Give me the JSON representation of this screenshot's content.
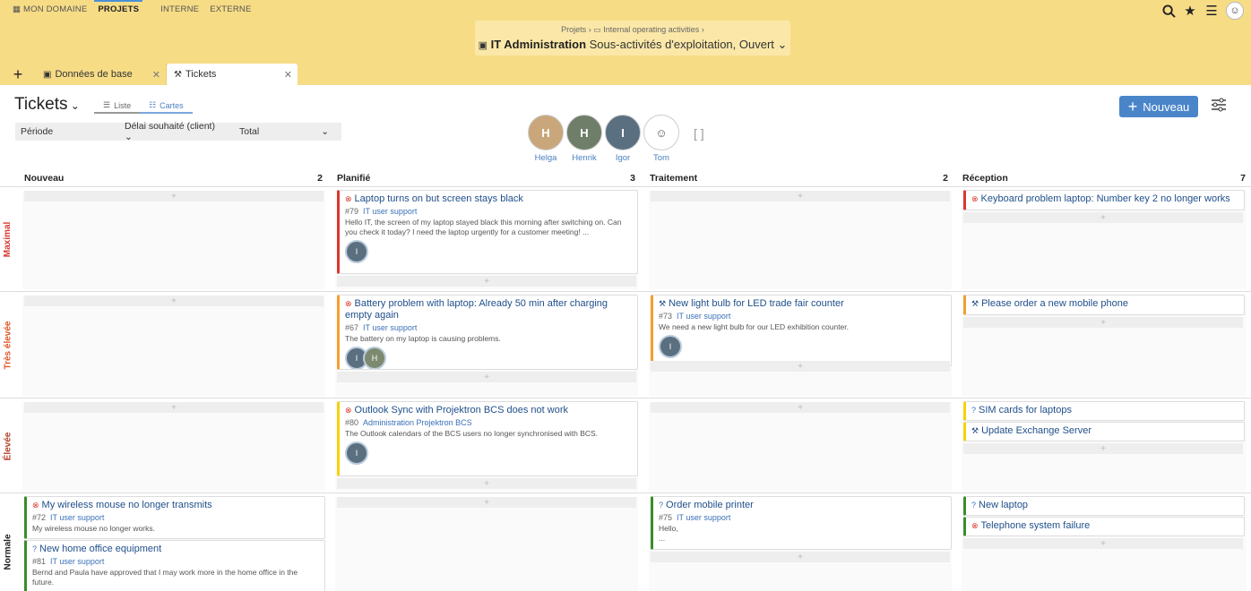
{
  "topnav": {
    "items": [
      {
        "label": "Mon domaine",
        "active": false
      },
      {
        "label": "Projets",
        "active": true
      },
      {
        "label": "Interne",
        "active": false
      },
      {
        "label": "Externe",
        "active": false
      }
    ],
    "icons": [
      "search-icon",
      "star-icon",
      "menu-icon",
      "user-avatar"
    ]
  },
  "project": {
    "crumb1": "Projets",
    "crumb_sep": "›",
    "crumb2": "Internal operating activities",
    "title": "IT Administration",
    "subtitle": "Sous-activités d'exploitation, Ouvert"
  },
  "tabs": [
    {
      "label": "Données de base"
    },
    {
      "label": "Tickets"
    }
  ],
  "page": {
    "title": "Tickets",
    "view_list": "Liste",
    "view_cards": "Cartes",
    "filter_period": "Période",
    "filter_deadline": "Délai souhaité (client)",
    "filter_total": "Total",
    "new_button": "Nouveau"
  },
  "people": [
    "Helga",
    "Henrik",
    "Igor",
    "Tom"
  ],
  "columns": [
    {
      "name": "Nouveau",
      "count": "2"
    },
    {
      "name": "Planifié",
      "count": "3"
    },
    {
      "name": "Traitement",
      "count": "2"
    },
    {
      "name": "Réception",
      "count": "7"
    }
  ],
  "lanes": [
    {
      "name": "Maximal",
      "color": "#d9372d"
    },
    {
      "name": "Très élevée",
      "color": "#e2572b"
    },
    {
      "name": "Élevée",
      "color": "#b4432c"
    },
    {
      "name": "Normale",
      "color": "#222222"
    }
  ],
  "cards": {
    "c79": {
      "title": "Laptop turns on but screen stays black",
      "id": "#79",
      "project": "IT user support",
      "desc": "Hello IT, the screen of my laptop stayed black this morning after switching on. Can you check it today? I need the laptop urgently for a customer meeting! ..."
    },
    "c_kb": {
      "title": "Keyboard problem laptop: Number key 2 no longer works"
    },
    "c67": {
      "title": "Battery problem with laptop: Already 50 min after charging empty again",
      "id": "#67",
      "project": "IT user support",
      "desc": "The battery on my laptop is causing problems."
    },
    "c73": {
      "title": "New light bulb for LED trade fair counter",
      "id": "#73",
      "project": "IT user support",
      "desc": "We need a new light bulb for our LED exhibition counter."
    },
    "c_phone": {
      "title": "Please order a new mobile phone"
    },
    "c80": {
      "title": "Outlook Sync with Projektron BCS does not work",
      "id": "#80",
      "project": "Administration Projektron BCS",
      "desc": "The Outlook calendars of the BCS users no longer synchronised with BCS."
    },
    "c_sim": {
      "title": "SIM cards for laptops"
    },
    "c_exch": {
      "title": "Update Exchange Server"
    },
    "c72": {
      "title": "My wireless mouse no longer transmits",
      "id": "#72",
      "project": "IT user support",
      "desc": "My wireless mouse no longer works."
    },
    "c81": {
      "title": "New home office equipment",
      "id": "#81",
      "project": "IT user support",
      "desc": "Bernd and Paula have approved that I may work more in the home office in the future."
    },
    "c75": {
      "title": "Order mobile printer",
      "id": "#75",
      "project": "IT user support",
      "desc1": "Hello,",
      "desc2": "..."
    },
    "c_laptop": {
      "title": "New laptop"
    },
    "c_tel": {
      "title": "Telephone system failure"
    }
  }
}
